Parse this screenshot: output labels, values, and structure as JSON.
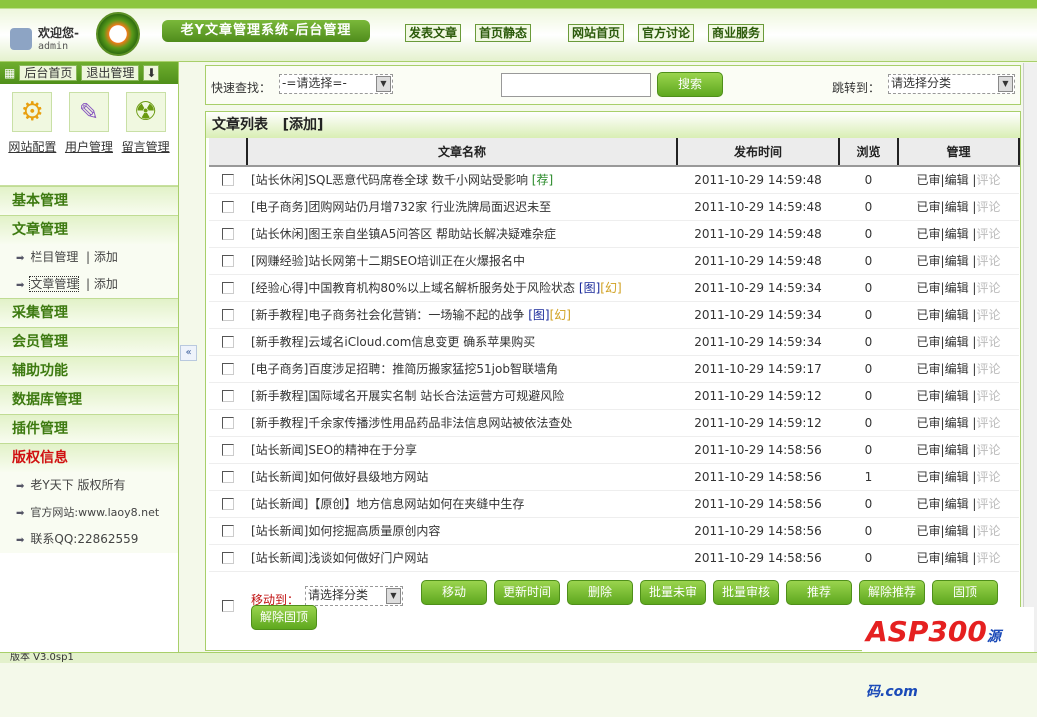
{
  "header": {
    "welcome": "欢迎您-",
    "user": "admin",
    "system_title": "老Y文章管理系统-后台管理",
    "nav": [
      "发表文章",
      "首页静态",
      "网站首页",
      "官方讨论",
      "商业服务"
    ]
  },
  "left": {
    "top_buttons": [
      "后台首页",
      "退出管理"
    ],
    "quick": [
      {
        "label": "网站配置",
        "icon": "gears-icon"
      },
      {
        "label": "用户管理",
        "icon": "user-edit-icon"
      },
      {
        "label": "留言管理",
        "icon": "radiation-icon"
      }
    ],
    "menu": [
      {
        "title": "基本管理"
      },
      {
        "title": "文章管理",
        "items": [
          {
            "label": "栏目管理",
            "extra": "添加"
          },
          {
            "label": "文章管理",
            "extra": "添加"
          }
        ]
      },
      {
        "title": "采集管理"
      },
      {
        "title": "会员管理"
      },
      {
        "title": "辅助功能"
      },
      {
        "title": "数据库管理"
      },
      {
        "title": "插件管理"
      },
      {
        "title": "版权信息",
        "red": true,
        "items": [
          {
            "label": "老Y天下 版权所有"
          },
          {
            "label": "官方网站:www.laoy8.net"
          },
          {
            "label": "联系QQ:22862559"
          }
        ]
      }
    ],
    "version": "版本 V3.0sp1"
  },
  "search": {
    "label": "快速查找：",
    "select": "-=请选择=-",
    "input": "",
    "button": "搜索",
    "jump_label": "跳转到：",
    "jump_select": "请选择分类"
  },
  "list": {
    "title": "文章列表",
    "add": "[添加]",
    "columns": [
      "文章名称",
      "发布时间",
      "浏览",
      "管理"
    ],
    "rows": [
      {
        "cat": "[站长休闲]",
        "title": "SQL恶意代码席卷全球 数千小网站受影响",
        "tags": [
          {
            "t": "[荐]",
            "c": "g"
          }
        ],
        "time": "2011-10-29 14:59:48",
        "views": "0"
      },
      {
        "cat": "[电子商务]",
        "title": "团购网站仍月增732家 行业洗牌局面迟迟未至",
        "tags": [],
        "time": "2011-10-29 14:59:48",
        "views": "0"
      },
      {
        "cat": "[站长休闲]",
        "title": "图王亲自坐镇A5问答区 帮助站长解决疑难杂症",
        "tags": [],
        "time": "2011-10-29 14:59:48",
        "views": "0"
      },
      {
        "cat": "[网赚经验]",
        "title": "站长网第十二期SEO培训正在火爆报名中",
        "tags": [],
        "time": "2011-10-29 14:59:48",
        "views": "0"
      },
      {
        "cat": "[经验心得]",
        "title": "中国教育机构80%以上域名解析服务处于风险状态",
        "tags": [
          {
            "t": "[图]",
            "c": "b"
          },
          {
            "t": "[幻]",
            "c": "y"
          }
        ],
        "time": "2011-10-29 14:59:34",
        "views": "0"
      },
      {
        "cat": "[新手教程]",
        "title": "电子商务社会化营销：一场输不起的战争",
        "tags": [
          {
            "t": "[图]",
            "c": "b"
          },
          {
            "t": "[幻]",
            "c": "y"
          }
        ],
        "time": "2011-10-29 14:59:34",
        "views": "0"
      },
      {
        "cat": "[新手教程]",
        "title": "云域名iCloud.com信息变更 确系苹果购买",
        "tags": [],
        "time": "2011-10-29 14:59:34",
        "views": "0"
      },
      {
        "cat": "[电子商务]",
        "title": "百度涉足招聘：推简历搬家猛挖51job智联墙角",
        "tags": [],
        "time": "2011-10-29 14:59:17",
        "views": "0"
      },
      {
        "cat": "[新手教程]",
        "title": "国际域名开展实名制 站长合法运营方可规避风险",
        "tags": [],
        "time": "2011-10-29 14:59:12",
        "views": "0"
      },
      {
        "cat": "[新手教程]",
        "title": "千余家传播涉性用品药品非法信息网站被依法查处",
        "tags": [],
        "time": "2011-10-29 14:59:12",
        "views": "0"
      },
      {
        "cat": "[站长新闻]",
        "title": "SEO的精神在于分享",
        "tags": [],
        "time": "2011-10-29 14:58:56",
        "views": "0"
      },
      {
        "cat": "[站长新闻]",
        "title": "如何做好县级地方网站",
        "tags": [],
        "time": "2011-10-29 14:58:56",
        "views": "1"
      },
      {
        "cat": "[站长新闻]",
        "title": "【原创】地方信息网站如何在夹缝中生存",
        "tags": [],
        "time": "2011-10-29 14:58:56",
        "views": "0"
      },
      {
        "cat": "[站长新闻]",
        "title": "如何挖掘高质量原创内容",
        "tags": [],
        "time": "2011-10-29 14:58:56",
        "views": "0"
      },
      {
        "cat": "[站长新闻]",
        "title": "浅谈如何做好门户网站",
        "tags": [],
        "time": "2011-10-29 14:58:56",
        "views": "0"
      }
    ],
    "actions": {
      "audited": "已审",
      "edit": "编辑",
      "comment": "评论"
    }
  },
  "batch": {
    "move_label": "移动到：",
    "move_select": "请选择分类",
    "buttons": [
      "移动",
      "更新时间",
      "删除",
      "批量未审",
      "批量审核",
      "推荐",
      "解除推荐",
      "固顶",
      "解除固顶"
    ]
  },
  "watermark": "ASP300源码.com"
}
